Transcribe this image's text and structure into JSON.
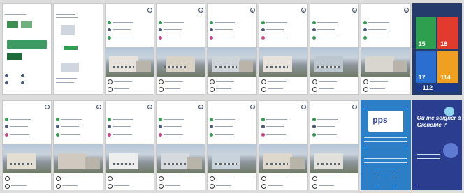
{
  "row1": [
    {
      "title": "",
      "num": ""
    },
    {
      "title": "",
      "num": ""
    },
    {
      "title": "",
      "num": "1"
    },
    {
      "title": "",
      "num": "2"
    },
    {
      "title": "",
      "num": "3"
    },
    {
      "title": "",
      "num": "4"
    },
    {
      "title": "",
      "num": "5"
    },
    {
      "title": "",
      "num": "6"
    },
    {
      "title": "",
      "num": ""
    }
  ],
  "emergency": {
    "numbers": [
      "15",
      "18",
      "17",
      "114"
    ],
    "eu": "112"
  },
  "row2": [
    {
      "title": "",
      "num": "7"
    },
    {
      "title": "",
      "num": "8"
    },
    {
      "title": "",
      "num": "9"
    },
    {
      "title": "",
      "num": "10"
    },
    {
      "title": "",
      "num": "11"
    },
    {
      "title": "",
      "num": "12"
    },
    {
      "title": "",
      "num": "13"
    }
  ],
  "pps": {
    "logo": "pps"
  },
  "cover": {
    "question": "Où me soigner à Grenoble ?"
  },
  "colors": {
    "accent": "#243b6b",
    "green": "#2e9e4f",
    "red": "#e23b2e",
    "blue": "#2a6fd0",
    "orange": "#f0a020",
    "pps_blue": "#2c7fc7",
    "cover_navy": "#2b3d8f"
  }
}
